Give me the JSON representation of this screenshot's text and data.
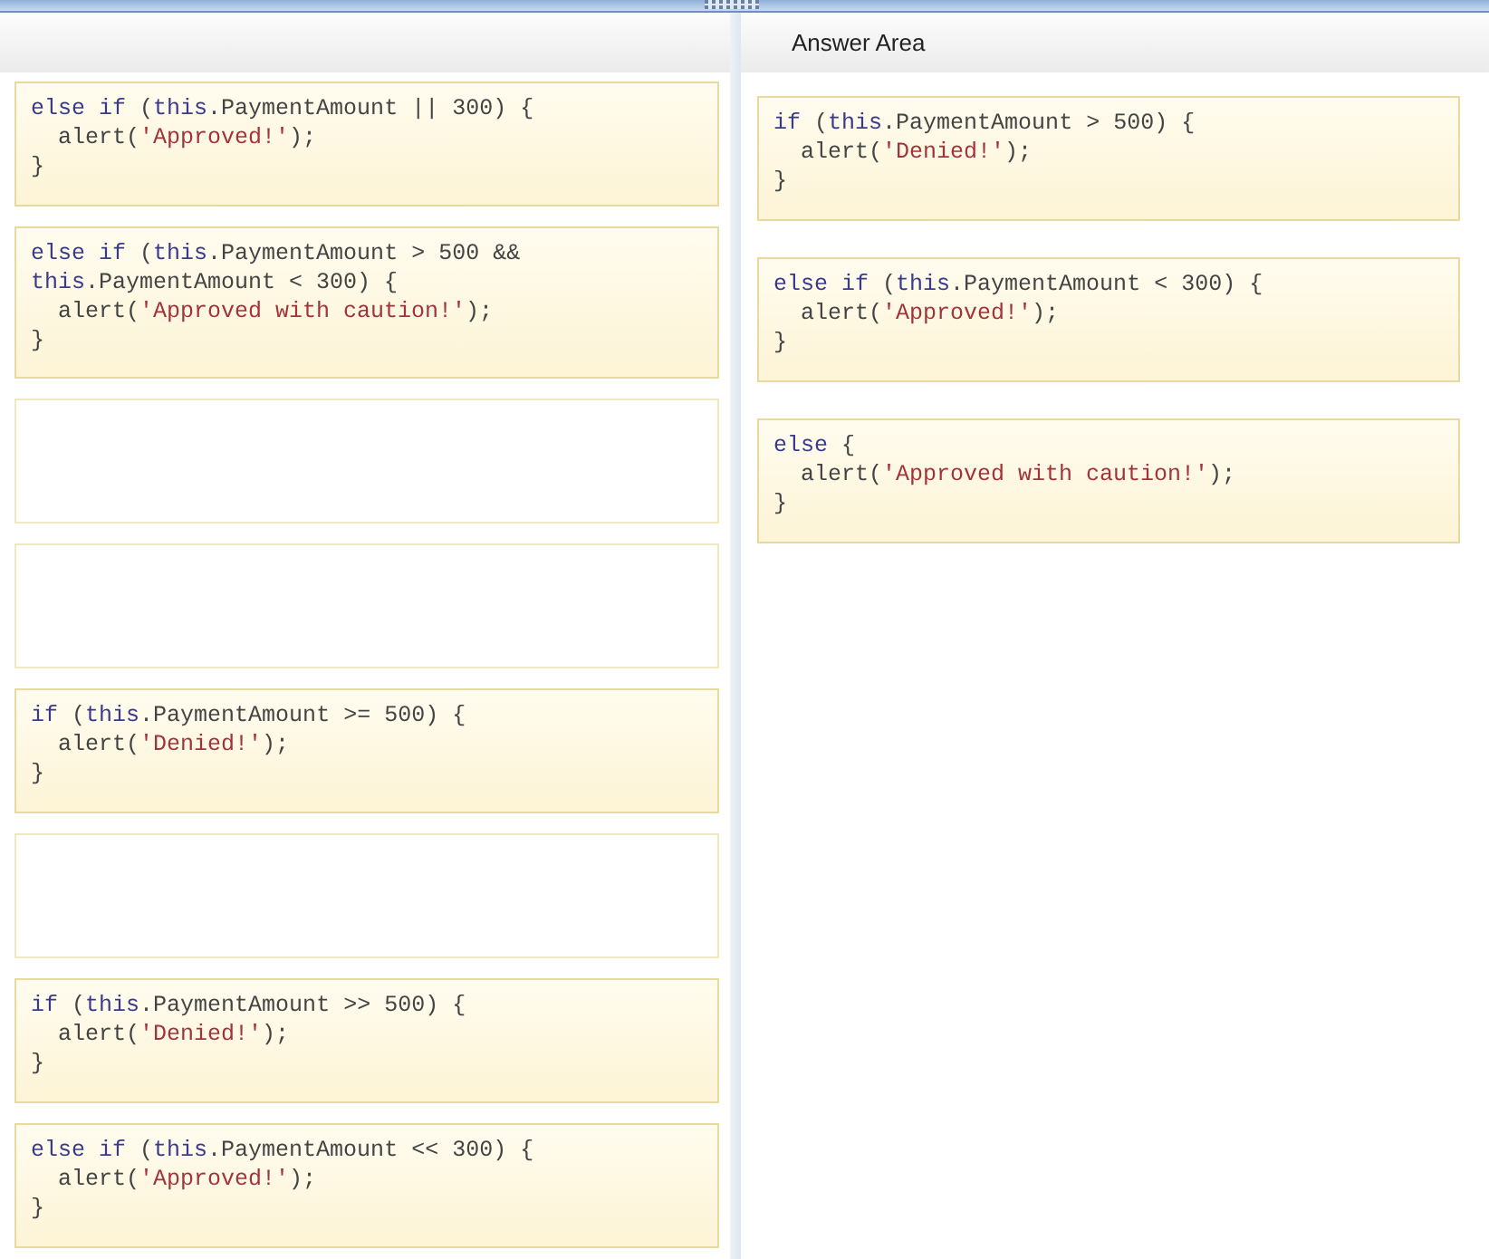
{
  "source_pane": {
    "slots": [
      {
        "kind": "code",
        "lines": [
          [
            {
              "kind": "keyword",
              "text": "else if"
            },
            {
              "kind": "plain",
              "text": " ("
            },
            {
              "kind": "keyword",
              "text": "this"
            },
            {
              "kind": "plain",
              "text": ".PaymentAmount || 300) {"
            }
          ],
          [
            {
              "kind": "plain",
              "text": "  alert("
            },
            {
              "kind": "string",
              "text": "'Approved!'"
            },
            {
              "kind": "plain",
              "text": ");"
            }
          ],
          [
            {
              "kind": "plain",
              "text": "}"
            }
          ]
        ]
      },
      {
        "kind": "code",
        "lines": [
          [
            {
              "kind": "keyword",
              "text": "else if"
            },
            {
              "kind": "plain",
              "text": " ("
            },
            {
              "kind": "keyword",
              "text": "this"
            },
            {
              "kind": "plain",
              "text": ".PaymentAmount > 500 &&"
            }
          ],
          [
            {
              "kind": "keyword",
              "text": "this"
            },
            {
              "kind": "plain",
              "text": ".PaymentAmount < 300) {"
            }
          ],
          [
            {
              "kind": "plain",
              "text": "  alert("
            },
            {
              "kind": "string",
              "text": "'Approved with caution!'"
            },
            {
              "kind": "plain",
              "text": ");"
            }
          ],
          [
            {
              "kind": "plain",
              "text": "}"
            }
          ]
        ]
      },
      {
        "kind": "empty"
      },
      {
        "kind": "empty"
      },
      {
        "kind": "code",
        "lines": [
          [
            {
              "kind": "keyword",
              "text": "if"
            },
            {
              "kind": "plain",
              "text": " ("
            },
            {
              "kind": "keyword",
              "text": "this"
            },
            {
              "kind": "plain",
              "text": ".PaymentAmount >= 500) {"
            }
          ],
          [
            {
              "kind": "plain",
              "text": "  alert("
            },
            {
              "kind": "string",
              "text": "'Denied!'"
            },
            {
              "kind": "plain",
              "text": ");"
            }
          ],
          [
            {
              "kind": "plain",
              "text": "}"
            }
          ]
        ]
      },
      {
        "kind": "empty"
      },
      {
        "kind": "code",
        "lines": [
          [
            {
              "kind": "keyword",
              "text": "if"
            },
            {
              "kind": "plain",
              "text": " ("
            },
            {
              "kind": "keyword",
              "text": "this"
            },
            {
              "kind": "plain",
              "text": ".PaymentAmount >> 500) {"
            }
          ],
          [
            {
              "kind": "plain",
              "text": "  alert("
            },
            {
              "kind": "string",
              "text": "'Denied!'"
            },
            {
              "kind": "plain",
              "text": ");"
            }
          ],
          [
            {
              "kind": "plain",
              "text": "}"
            }
          ]
        ]
      },
      {
        "kind": "code",
        "lines": [
          [
            {
              "kind": "keyword",
              "text": "else if"
            },
            {
              "kind": "plain",
              "text": " ("
            },
            {
              "kind": "keyword",
              "text": "this"
            },
            {
              "kind": "plain",
              "text": ".PaymentAmount << 300) {"
            }
          ],
          [
            {
              "kind": "plain",
              "text": "  alert("
            },
            {
              "kind": "string",
              "text": "'Approved!'"
            },
            {
              "kind": "plain",
              "text": ");"
            }
          ],
          [
            {
              "kind": "plain",
              "text": "}"
            }
          ]
        ]
      }
    ]
  },
  "answer_area": {
    "title": "Answer Area",
    "slots": [
      {
        "kind": "code",
        "lines": [
          [
            {
              "kind": "keyword",
              "text": "if"
            },
            {
              "kind": "plain",
              "text": " ("
            },
            {
              "kind": "keyword",
              "text": "this"
            },
            {
              "kind": "plain",
              "text": ".PaymentAmount > 500) {"
            }
          ],
          [
            {
              "kind": "plain",
              "text": "  alert("
            },
            {
              "kind": "string",
              "text": "'Denied!'"
            },
            {
              "kind": "plain",
              "text": ");"
            }
          ],
          [
            {
              "kind": "plain",
              "text": "}"
            }
          ]
        ]
      },
      {
        "kind": "code",
        "lines": [
          [
            {
              "kind": "keyword",
              "text": "else if"
            },
            {
              "kind": "plain",
              "text": " ("
            },
            {
              "kind": "keyword",
              "text": "this"
            },
            {
              "kind": "plain",
              "text": ".PaymentAmount < 300) {"
            }
          ],
          [
            {
              "kind": "plain",
              "text": "  alert("
            },
            {
              "kind": "string",
              "text": "'Approved!'"
            },
            {
              "kind": "plain",
              "text": ");"
            }
          ],
          [
            {
              "kind": "plain",
              "text": "}"
            }
          ]
        ]
      },
      {
        "kind": "code",
        "lines": [
          [
            {
              "kind": "keyword",
              "text": "else"
            },
            {
              "kind": "plain",
              "text": " {"
            }
          ],
          [
            {
              "kind": "plain",
              "text": "  alert("
            },
            {
              "kind": "string",
              "text": "'Approved with caution!'"
            },
            {
              "kind": "plain",
              "text": ");"
            }
          ],
          [
            {
              "kind": "plain",
              "text": "}"
            }
          ]
        ]
      }
    ]
  }
}
